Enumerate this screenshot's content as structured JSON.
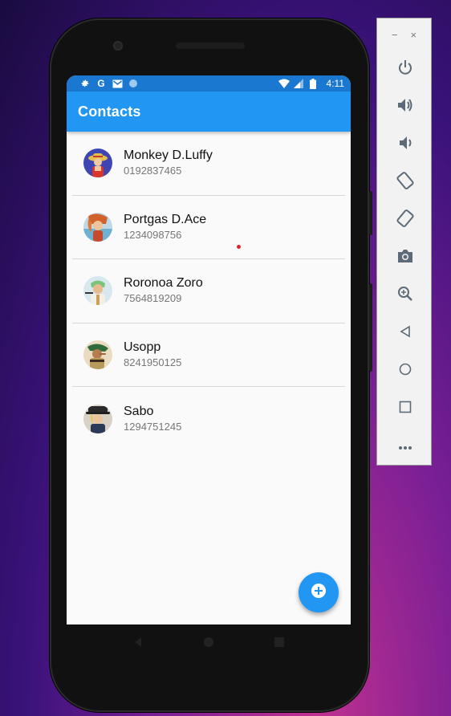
{
  "statusbar": {
    "icons": [
      "gear-icon",
      "google-g-icon",
      "gmail-icon",
      "circle-icon",
      "wifi-icon",
      "signal-icon",
      "battery-icon"
    ],
    "google_glyph": "G",
    "time": "4:11"
  },
  "appbar": {
    "title": "Contacts",
    "color": "#2196f3"
  },
  "contacts": [
    {
      "name": "Monkey D.Luffy",
      "phone": "0192837465",
      "avatar": "luffy-avatar"
    },
    {
      "name": "Portgas D.Ace",
      "phone": "1234098756",
      "avatar": "ace-avatar"
    },
    {
      "name": "Roronoa Zoro",
      "phone": "7564819209",
      "avatar": "zoro-avatar"
    },
    {
      "name": "Usopp",
      "phone": "8241950125",
      "avatar": "usopp-avatar"
    },
    {
      "name": "Sabo",
      "phone": "1294751245",
      "avatar": "sabo-avatar"
    }
  ],
  "fab": {
    "icon": "add-circle-icon"
  },
  "navbar": {
    "icons": [
      "back-icon",
      "home-icon",
      "recents-icon"
    ]
  },
  "emulator_toolbar": {
    "window_controls": {
      "minimize": "−",
      "close": "×"
    },
    "tools": [
      "power-icon",
      "volume-up-icon",
      "volume-down-icon",
      "rotate-left-icon",
      "rotate-right-icon",
      "screenshot-icon",
      "zoom-icon",
      "back-icon",
      "home-icon",
      "overview-icon",
      "more-icon"
    ]
  }
}
